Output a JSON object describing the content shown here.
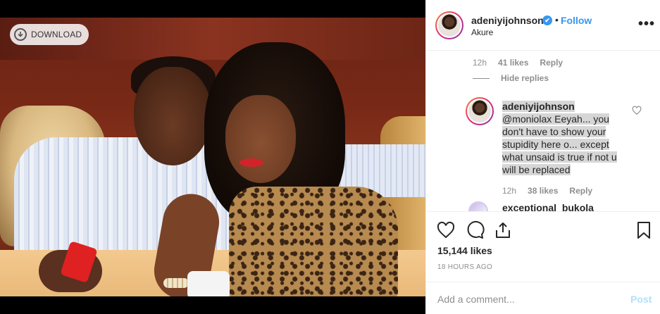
{
  "photo": {
    "download_label": "DOWNLOAD"
  },
  "header": {
    "username": "adeniyijohnson",
    "verified_mark": "✔",
    "separator": "•",
    "follow_label": "Follow",
    "location": "Akure",
    "more_label": "•••"
  },
  "comments": {
    "first_meta": {
      "time": "12h",
      "likes": "41 likes",
      "reply": "Reply"
    },
    "hide_replies_label": "Hide replies",
    "reply_comment": {
      "username": "adeniyijohnson",
      "text": "@moniolax Eeyah... you don't have to show your stupidity here o... except what unsaid is true if not u will be replaced"
    },
    "second_meta": {
      "time": "12h",
      "likes": "38 likes",
      "reply": "Reply"
    },
    "next_username": "exceptional_bukola"
  },
  "actions": {
    "icons": [
      "heart-icon",
      "comment-icon",
      "share-icon",
      "bookmark-icon"
    ],
    "likes_count": "15,144 likes",
    "timestamp": "18 HOURS AGO"
  },
  "add_comment": {
    "placeholder": "Add a comment...",
    "post_label": "Post"
  },
  "colors": {
    "accent": "#3897f0",
    "post_disabled": "#b2dffc",
    "muted": "#8e8e8e",
    "highlight": "#d6d6d6"
  }
}
